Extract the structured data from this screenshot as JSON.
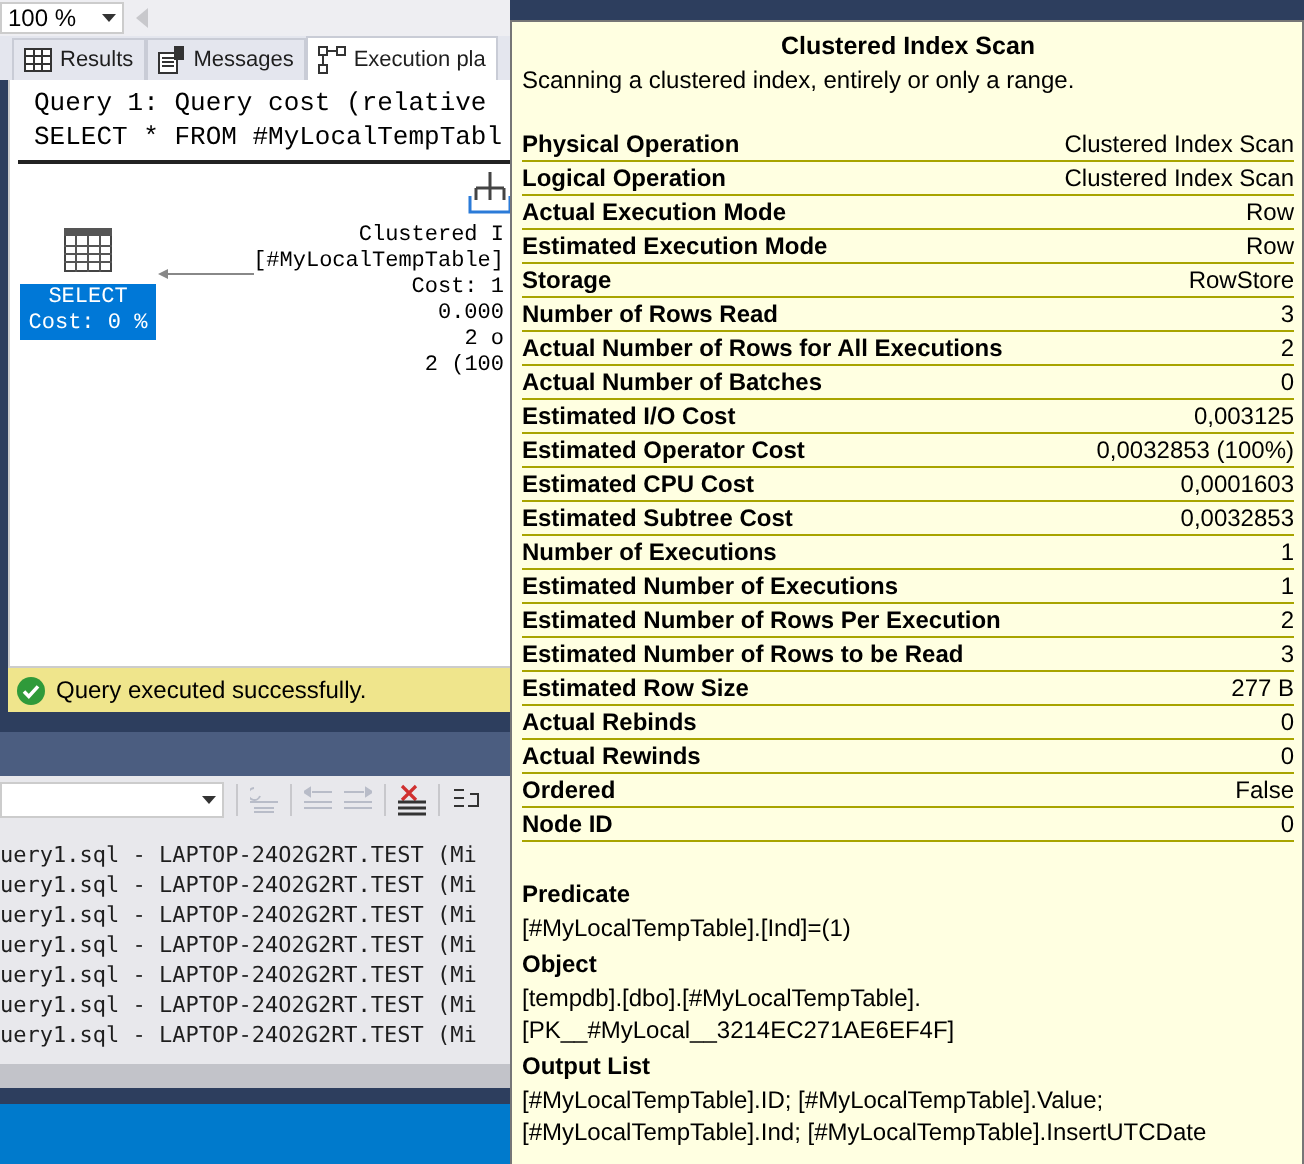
{
  "toolbar": {
    "zoom": "100 %"
  },
  "tabs": [
    {
      "label": "Results",
      "kind": "grid",
      "selected": false
    },
    {
      "label": "Messages",
      "kind": "messages",
      "selected": false
    },
    {
      "label": "Execution pla",
      "kind": "plan",
      "selected": true
    }
  ],
  "query_header": [
    "Query 1: Query cost (relative",
    "SELECT * FROM #MyLocalTempTabl"
  ],
  "plan": {
    "select_node": {
      "label": "SELECT",
      "cost": "Cost: 0 %",
      "selected": true
    },
    "scan_node": {
      "lines": [
        "Clustered I",
        "[#MyLocalTempTable]",
        "Cost: 1",
        "0.000",
        "2 o",
        "2 (100"
      ]
    }
  },
  "status": {
    "kind": "success",
    "message": "Query executed successfully."
  },
  "output": {
    "lines": [
      "uery1.sql - LAPTOP-24O2G2RT.TEST (Mi",
      "uery1.sql - LAPTOP-24O2G2RT.TEST (Mi",
      "uery1.sql - LAPTOP-24O2G2RT.TEST (Mi",
      "uery1.sql - LAPTOP-24O2G2RT.TEST (Mi",
      "uery1.sql - LAPTOP-24O2G2RT.TEST (Mi",
      "uery1.sql - LAPTOP-24O2G2RT.TEST (Mi",
      "uery1.sql - LAPTOP-24O2G2RT.TEST (Mi"
    ]
  },
  "tooltip": {
    "title": "Clustered Index Scan",
    "description": "Scanning a clustered index, entirely or only a range.",
    "properties": [
      {
        "name": "Physical Operation",
        "value": "Clustered Index Scan"
      },
      {
        "name": "Logical Operation",
        "value": "Clustered Index Scan"
      },
      {
        "name": "Actual Execution Mode",
        "value": "Row"
      },
      {
        "name": "Estimated Execution Mode",
        "value": "Row"
      },
      {
        "name": "Storage",
        "value": "RowStore"
      },
      {
        "name": "Number of Rows Read",
        "value": "3"
      },
      {
        "name": "Actual Number of Rows for All Executions",
        "value": "2"
      },
      {
        "name": "Actual Number of Batches",
        "value": "0"
      },
      {
        "name": "Estimated I/O Cost",
        "value": "0,003125"
      },
      {
        "name": "Estimated Operator Cost",
        "value": "0,0032853 (100%)"
      },
      {
        "name": "Estimated CPU Cost",
        "value": "0,0001603"
      },
      {
        "name": "Estimated Subtree Cost",
        "value": "0,0032853"
      },
      {
        "name": "Number of Executions",
        "value": "1"
      },
      {
        "name": "Estimated Number of Executions",
        "value": "1"
      },
      {
        "name": "Estimated Number of Rows Per Execution",
        "value": "2"
      },
      {
        "name": "Estimated Number of Rows to be Read",
        "value": "3"
      },
      {
        "name": "Estimated Row Size",
        "value": "277 B"
      },
      {
        "name": "Actual Rebinds",
        "value": "0"
      },
      {
        "name": "Actual Rewinds",
        "value": "0"
      },
      {
        "name": "Ordered",
        "value": "False"
      },
      {
        "name": "Node ID",
        "value": "0"
      }
    ],
    "sections": [
      {
        "heading": "Predicate",
        "lines": [
          "[#MyLocalTempTable].[Ind]=(1)"
        ]
      },
      {
        "heading": "Object",
        "lines": [
          "[tempdb].[dbo].[#MyLocalTempTable].",
          "[PK__#MyLocal__3214EC271AE6EF4F]"
        ]
      },
      {
        "heading": "Output List",
        "lines": [
          "[#MyLocalTempTable].ID; [#MyLocalTempTable].Value;",
          "[#MyLocalTempTable].Ind; [#MyLocalTempTable].InsertUTCDate"
        ]
      }
    ]
  }
}
